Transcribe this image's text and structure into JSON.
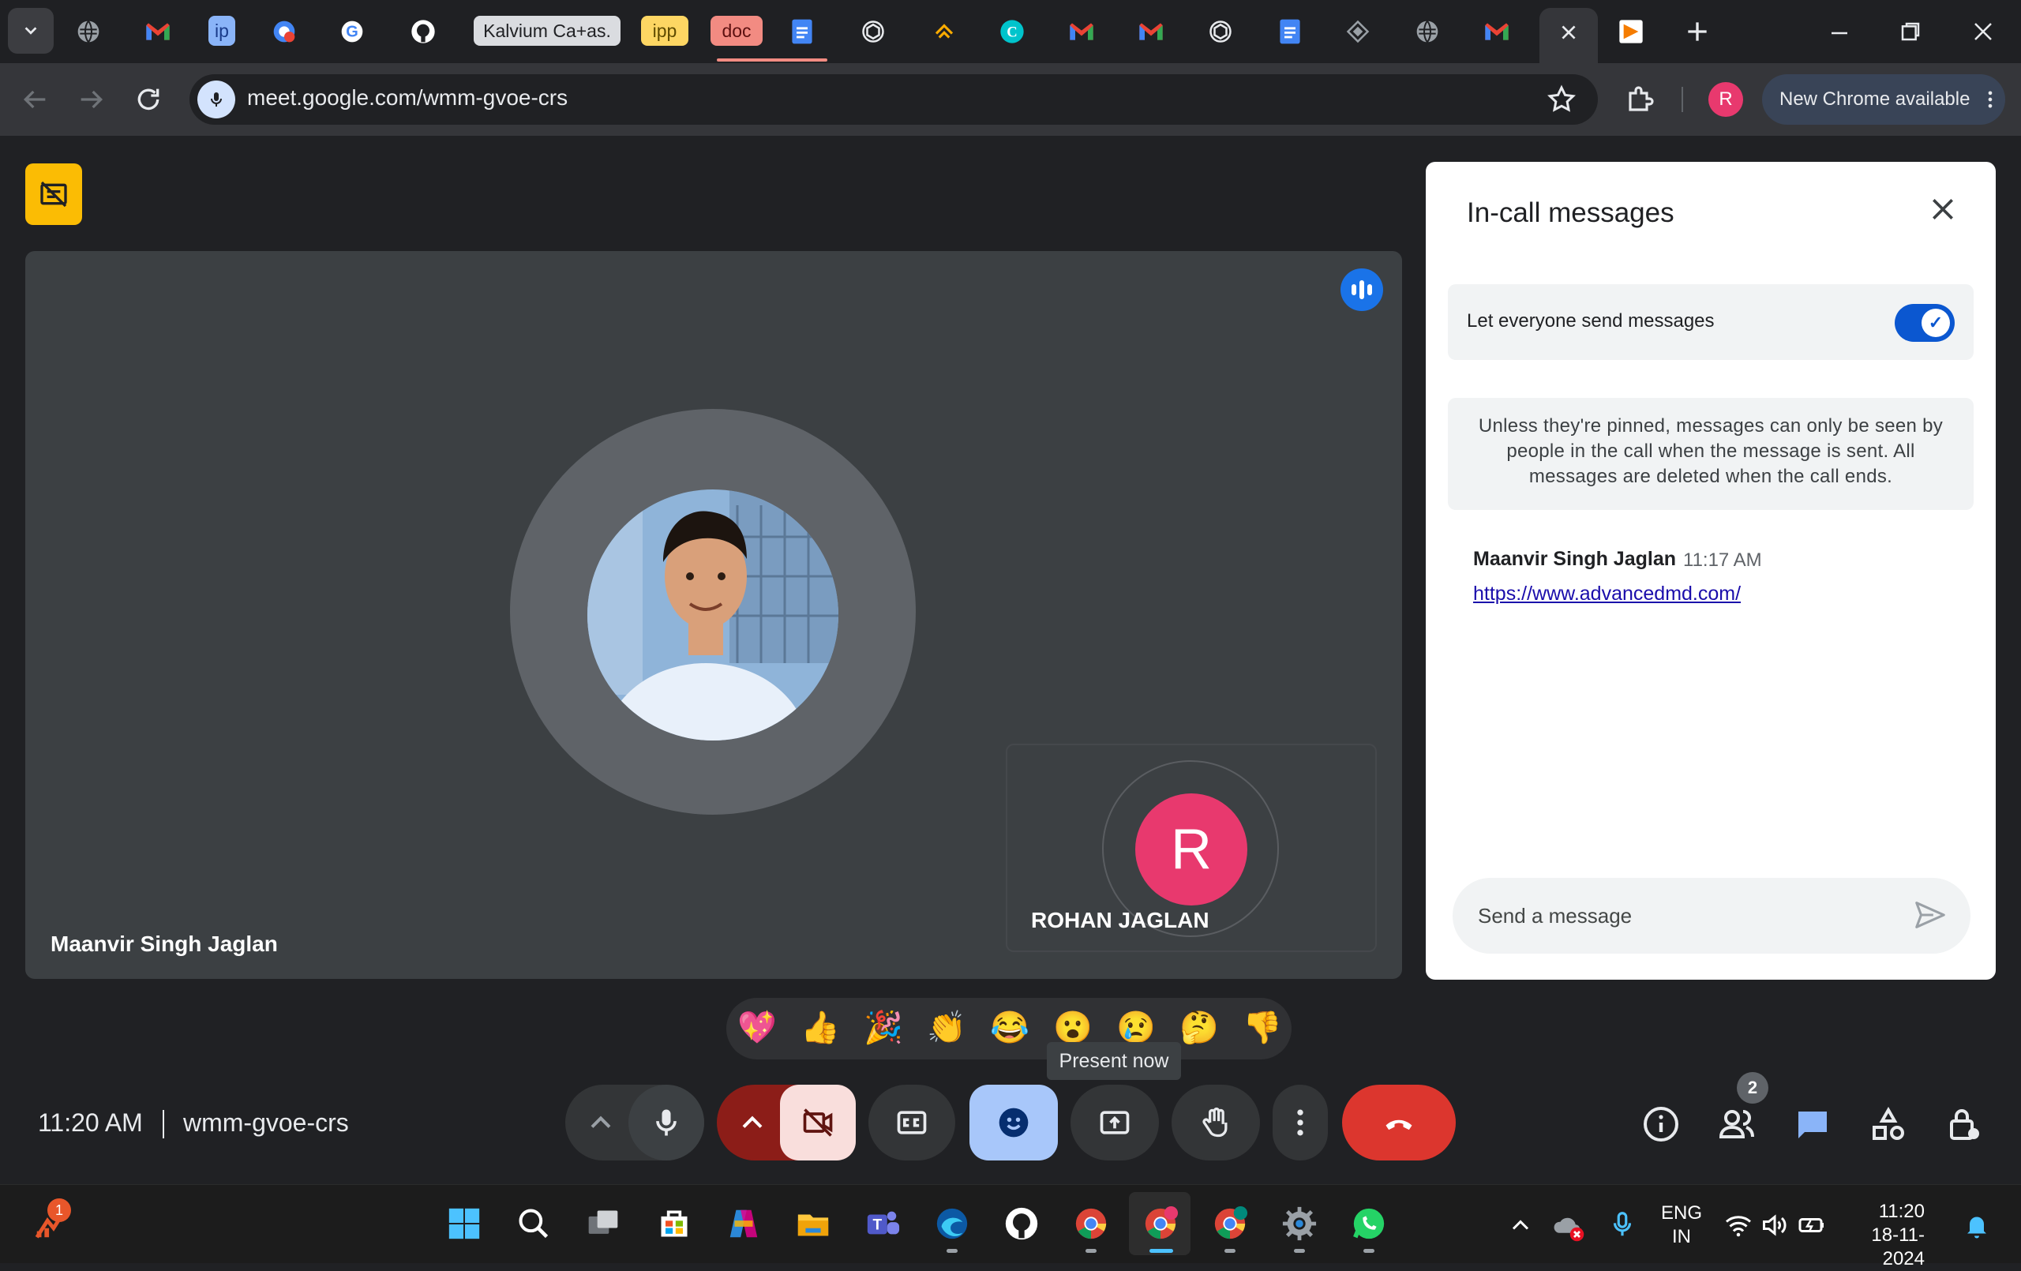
{
  "browser": {
    "tabs": [
      {
        "icon": "globe-icon"
      },
      {
        "icon": "gmail-icon"
      },
      {
        "label": "ip"
      },
      {
        "icon": "chrome-remote-icon"
      },
      {
        "icon": "google-icon"
      },
      {
        "icon": "github-icon"
      },
      {
        "label": "Kalvium Ca+as."
      },
      {
        "label": "ipp"
      },
      {
        "label": "doc"
      },
      {
        "icon": "docs-icon"
      },
      {
        "icon": "chatgpt-icon"
      },
      {
        "icon": "brave-icon"
      },
      {
        "icon": "canva-icon"
      },
      {
        "icon": "gmail-icon"
      },
      {
        "icon": "gmail-icon"
      },
      {
        "icon": "chatgpt-icon"
      },
      {
        "icon": "docs-icon"
      },
      {
        "icon": "diamond-icon"
      },
      {
        "icon": "globe-icon"
      },
      {
        "icon": "gmail-icon"
      },
      {
        "icon": "meet-icon",
        "active": true
      },
      {
        "icon": "orange-flag-icon"
      }
    ],
    "url": "meet.google.com/wmm-gvoe-crs",
    "profile_initial": "R",
    "update_label": "New Chrome available"
  },
  "meeting": {
    "main_participant": "Maanvir Singh Jaglan",
    "self_participant": "ROHAN JAGLAN",
    "self_initial": "R",
    "time": "11:20 AM",
    "code": "wmm-gvoe-crs",
    "people_count": "2"
  },
  "panel": {
    "title": "In-call messages",
    "toggle_label": "Let everyone send messages",
    "toggle_on": true,
    "info": "Unless they're pinned, messages can only be seen by people in the call when the message is sent. All messages are deleted when the call ends.",
    "messages": [
      {
        "sender": "Maanvir Singh Jaglan",
        "time": "11:17 AM",
        "text": "https://www.advancedmd.com/"
      }
    ],
    "input_placeholder": "Send a message"
  },
  "reactions": [
    "💖",
    "👍",
    "🎉",
    "👏",
    "😂",
    "😮",
    "😢",
    "🤔",
    "👎"
  ],
  "tooltip": "Present now",
  "taskbar": {
    "notification_count": "1",
    "lang_line1": "ENG",
    "lang_line2": "IN",
    "time": "11:20",
    "date": "18-11-2024"
  },
  "colors": {
    "meet_bg": "#202124",
    "tile_bg": "#3c4043",
    "end_call_red": "#ea4335",
    "reaction_active_blue": "#a8c7fa",
    "toggle_blue": "#0b57d0",
    "avatar_pink": "#e8396e",
    "camera_off_pink": "#f9dedc",
    "camera_off_dark_red": "#8c1d18"
  }
}
